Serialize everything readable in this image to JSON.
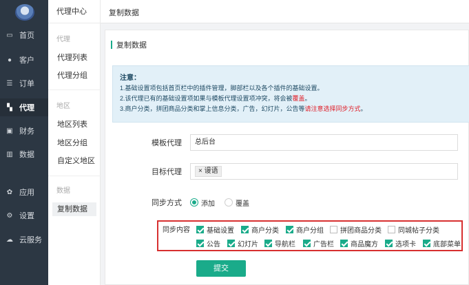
{
  "nav": {
    "items": [
      {
        "icon": "monitor-icon",
        "glyph": "▭",
        "label": "首页"
      },
      {
        "icon": "user-icon",
        "glyph": "●",
        "label": "客户"
      },
      {
        "icon": "list-icon",
        "glyph": "☰",
        "label": "订单"
      },
      {
        "icon": "map-icon",
        "glyph": "▚",
        "label": "代理"
      },
      {
        "icon": "money-icon",
        "glyph": "▣",
        "label": "财务"
      },
      {
        "icon": "chart-icon",
        "glyph": "▥",
        "label": "数据"
      },
      {
        "icon": "apps-icon",
        "glyph": "✿",
        "label": "应用"
      },
      {
        "icon": "gear-icon",
        "glyph": "⚙",
        "label": "设置"
      },
      {
        "icon": "cloud-icon",
        "glyph": "☁",
        "label": "云服务"
      }
    ]
  },
  "subnav": {
    "head": "代理中心",
    "group_agent": "代理",
    "agent_list": "代理列表",
    "agent_group": "代理分组",
    "group_region": "地区",
    "region_list": "地区列表",
    "region_group": "地区分组",
    "custom_region": "自定义地区",
    "group_data": "数据",
    "copy_data": "复制数据"
  },
  "topbar": {
    "title": "复制数据"
  },
  "panel": {
    "section_title": "复制数据",
    "notice": {
      "title": "注意：",
      "line1": "1.基础设置项包括首页栏中的插件管理，脚部栏以及各个插件的基础设置。",
      "line2_pre": "2.该代理已有的基础设置项如果与模板代理设置项冲突，将会被",
      "line2_red": "覆盖",
      "line2_post": "。",
      "line3_pre": "3.商户分类，拼团商品分类和掌上信息分类，广告，幻灯片，公告等",
      "line3_red": "请注意选择同步方式",
      "line3_post": "。"
    },
    "form": {
      "template_label": "模板代理",
      "template_value": "总后台",
      "target_label": "目标代理",
      "target_tag": "× 谩语",
      "sync_method_label": "同步方式",
      "sync_method_options": [
        {
          "label": "添加",
          "checked": true
        },
        {
          "label": "覆盖",
          "checked": false
        }
      ],
      "sync_content_label": "同步内容",
      "sync_items_row1": [
        {
          "label": "基础设置",
          "checked": true
        },
        {
          "label": "商户分类",
          "checked": true
        },
        {
          "label": "商户分组",
          "checked": true
        },
        {
          "label": "拼团商品分类",
          "checked": false
        },
        {
          "label": "同城帖子分类",
          "checked": false
        }
      ],
      "sync_items_row2": [
        {
          "label": "公告",
          "checked": true
        },
        {
          "label": "幻灯片",
          "checked": true
        },
        {
          "label": "导航栏",
          "checked": true
        },
        {
          "label": "广告栏",
          "checked": true
        },
        {
          "label": "商品魔方",
          "checked": true
        },
        {
          "label": "选项卡",
          "checked": true
        },
        {
          "label": "底部菜单",
          "checked": true
        }
      ],
      "submit_label": "提交"
    }
  },
  "colors": {
    "accent": "#1aab8a",
    "sidebar": "#2c3743",
    "alert_red": "#e0202a",
    "highlight_border": "#d72f2f"
  }
}
